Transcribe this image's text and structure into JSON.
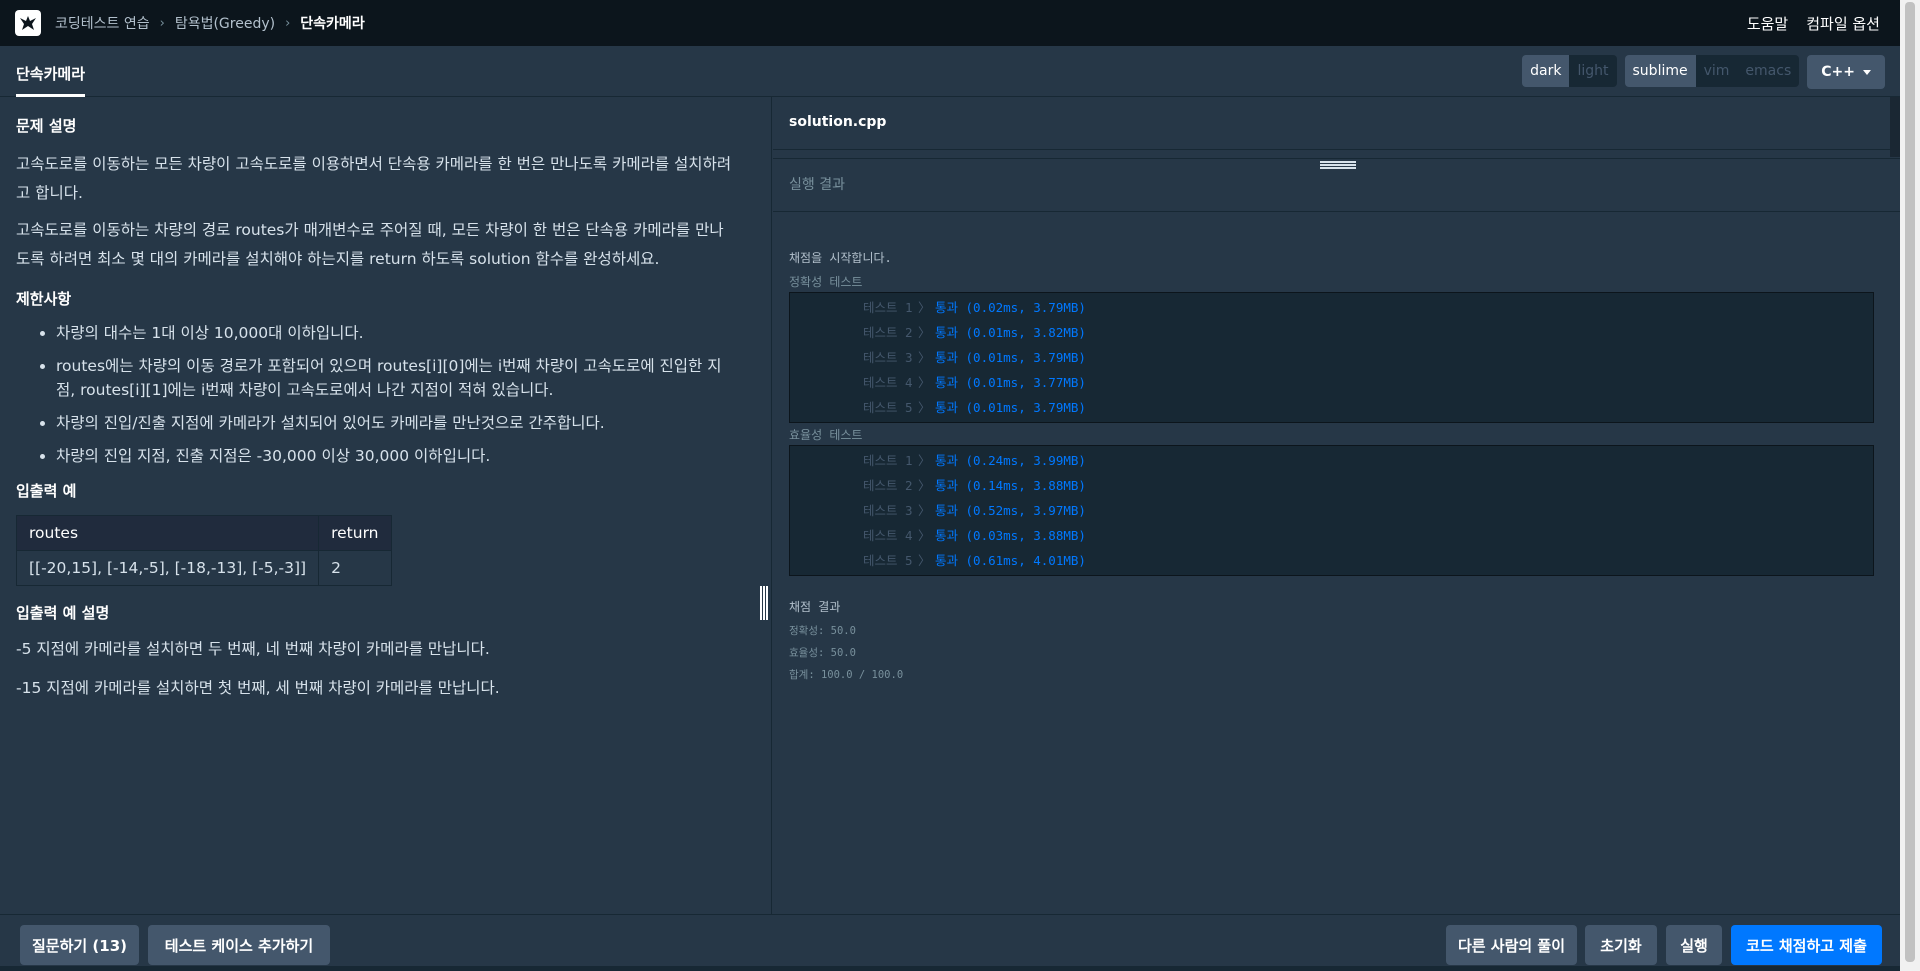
{
  "topbar": {
    "breadcrumbs": [
      "코딩테스트 연습",
      "탐욕법(Greedy)",
      "단속카메라"
    ],
    "help": "도움말",
    "compile_options": "컴파일 옵션"
  },
  "tabs": {
    "active": "단속카메라",
    "theme_dark": "dark",
    "theme_light": "light",
    "keymap_sublime": "sublime",
    "keymap_vim": "vim",
    "keymap_emacs": "emacs",
    "language": "C++"
  },
  "problem": {
    "desc_heading": "문제 설명",
    "desc_p1": "고속도로를 이동하는 모든 차량이 고속도로를 이용하면서 단속용 카메라를 한 번은 만나도록 카메라를 설치하려고 합니다.",
    "desc_p2": "고속도로를 이동하는 차량의 경로 routes가 매개변수로 주어질 때, 모든 차량이 한 번은 단속용 카메라를 만나도록 하려면 최소 몇 대의 카메라를 설치해야 하는지를 return 하도록 solution 함수를 완성하세요.",
    "constraints_heading": "제한사항",
    "constraints": [
      "차량의 대수는 1대 이상 10,000대 이하입니다.",
      "routes에는 차량의 이동 경로가 포함되어 있으며 routes[i][0]에는 i번째 차량이 고속도로에 진입한 지점, routes[i][1]에는 i번째 차량이 고속도로에서 나간 지점이 적혀 있습니다.",
      "차량의 진입/진출 지점에 카메라가 설치되어 있어도 카메라를 만난것으로 간주합니다.",
      "차량의 진입 지점, 진출 지점은 -30,000 이상 30,000 이하입니다."
    ],
    "io_heading": "입출력 예",
    "io_table": {
      "headers": [
        "routes",
        "return"
      ],
      "rows": [
        [
          "[[-20,15], [-14,-5], [-18,-13], [-5,-3]]",
          "2"
        ]
      ]
    },
    "io_explain_heading": "입출력 예 설명",
    "io_explain": [
      "-5 지점에 카메라를 설치하면 두 번째, 네 번째 차량이 카메라를 만납니다.",
      "-15 지점에 카메라를 설치하면 첫 번째, 세 번째 차량이 카메라를 만납니다."
    ]
  },
  "editor": {
    "filename": "solution.cpp",
    "run_result_title": "실행 결과"
  },
  "grading": {
    "start": "채점을 시작합니다.",
    "accuracy_title": "정확성  테스트",
    "efficiency_title": "효율성  테스트",
    "accuracy_tests": [
      {
        "label": "테스트 1",
        "result": "통과 (0.02ms, 3.79MB)"
      },
      {
        "label": "테스트 2",
        "result": "통과 (0.01ms, 3.82MB)"
      },
      {
        "label": "테스트 3",
        "result": "통과 (0.01ms, 3.79MB)"
      },
      {
        "label": "테스트 4",
        "result": "통과 (0.01ms, 3.77MB)"
      },
      {
        "label": "테스트 5",
        "result": "통과 (0.01ms, 3.79MB)"
      }
    ],
    "efficiency_tests": [
      {
        "label": "테스트 1",
        "result": "통과 (0.24ms, 3.99MB)"
      },
      {
        "label": "테스트 2",
        "result": "통과 (0.14ms, 3.88MB)"
      },
      {
        "label": "테스트 3",
        "result": "통과 (0.52ms, 3.97MB)"
      },
      {
        "label": "테스트 4",
        "result": "통과 (0.03ms, 3.88MB)"
      },
      {
        "label": "테스트 5",
        "result": "통과 (0.61ms, 4.01MB)"
      }
    ],
    "result_title": "채점 결과",
    "accuracy_score": "정확성: 50.0",
    "efficiency_score": "효율성: 50.0",
    "total_score": "합계: 100.0 / 100.0"
  },
  "bottom": {
    "ask": "질문하기 (13)",
    "add_testcase": "테스트 케이스 추가하기",
    "others_solutions": "다른 사람의 풀이",
    "reset": "초기화",
    "run": "실행",
    "submit": "코드 채점하고 제출"
  },
  "colors": {
    "background": "#263747",
    "topbar": "#0c151c",
    "accent": "#0078ff",
    "pass": "#0078ff"
  }
}
